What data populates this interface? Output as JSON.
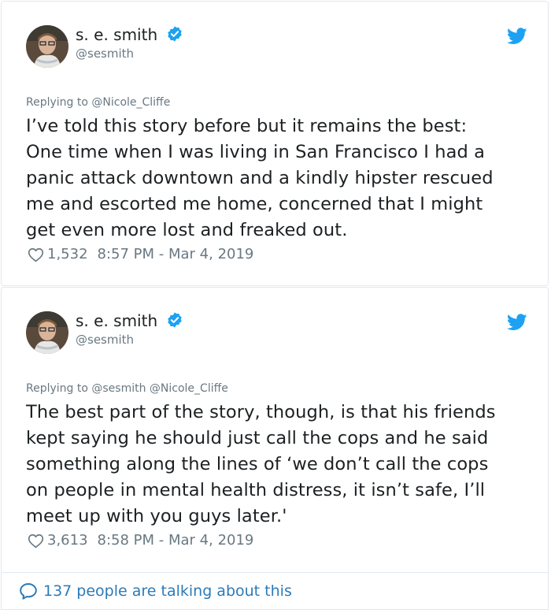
{
  "tweets": [
    {
      "author_name": "s. e. smith",
      "handle": "@sesmith",
      "replying_to": "Replying to @Nicole_Cliffe",
      "text": "I’ve told this story before but it remains the best:\nOne time when I was living in San Francisco I had a\npanic attack downtown and a kindly hipster rescued\nme and escorted me home, concerned that I might\nget even more lost and freaked out.",
      "likes": "1,532",
      "timestamp": "8:57 PM - Mar 4, 2019"
    },
    {
      "author_name": "s. e. smith",
      "handle": "@sesmith",
      "replying_to": "Replying to @sesmith @Nicole_Cliffe",
      "text": "The best part of the story, though, is that his friends\nkept saying he should just call the cops and he said\nsomething along the lines of ‘we don’t call the cops\non people in mental health distress, it isn’t safe, I’ll\nmeet up with you guys later.'",
      "likes": "3,613",
      "timestamp": "8:58 PM - Mar 4, 2019"
    }
  ],
  "footer": {
    "conversation_label": "137 people are talking about this"
  },
  "icons": {
    "verified": "verified-badge-icon",
    "twitter": "twitter-bird-icon",
    "like": "heart-icon",
    "conversation": "speech-bubble-icon"
  },
  "colors": {
    "twitter_blue": "#1da1f2",
    "link_blue": "#2b7bb9",
    "secondary_text": "#697882",
    "border": "#e1e8ed"
  }
}
